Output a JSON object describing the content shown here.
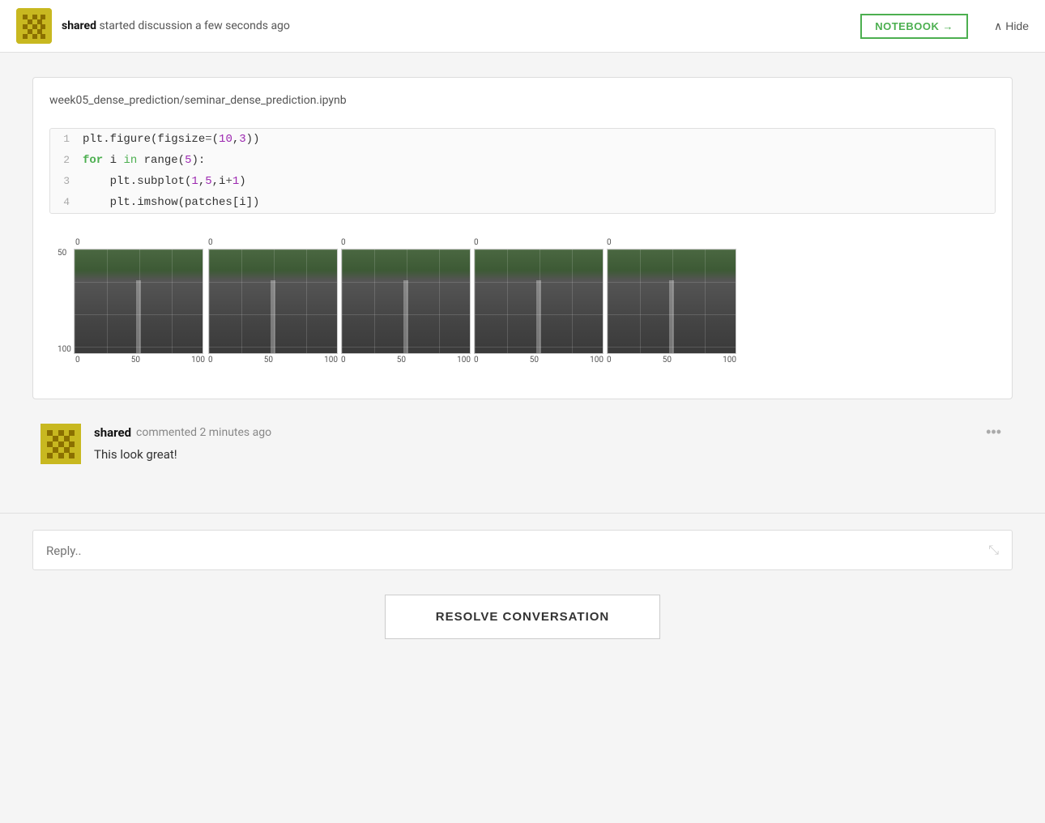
{
  "header": {
    "user": "shared",
    "action": "started discussion a few seconds ago",
    "notebook_btn": "NOTEBOOK →",
    "hide_btn": "Hide"
  },
  "notebook": {
    "path": "week05_dense_prediction/seminar_dense_prediction.ipynb",
    "code_lines": [
      {
        "num": "1",
        "content": "plt.figure(figsize=(10,3))"
      },
      {
        "num": "2",
        "content": "for i in range(5):"
      },
      {
        "num": "3",
        "content": "    plt.subplot(1,5,i+1)"
      },
      {
        "num": "4",
        "content": "    plt.imshow(patches[i])"
      }
    ],
    "plot": {
      "y_labels": [
        "0",
        "50",
        "100"
      ],
      "x_labels": [
        "0",
        "50",
        "100"
      ],
      "items_count": 5
    }
  },
  "comment": {
    "user": "shared",
    "action": "commented 2 minutes ago",
    "text": "This look great!"
  },
  "reply": {
    "placeholder": "Reply.."
  },
  "resolve_btn": "RESOLVE CONVERSATION"
}
